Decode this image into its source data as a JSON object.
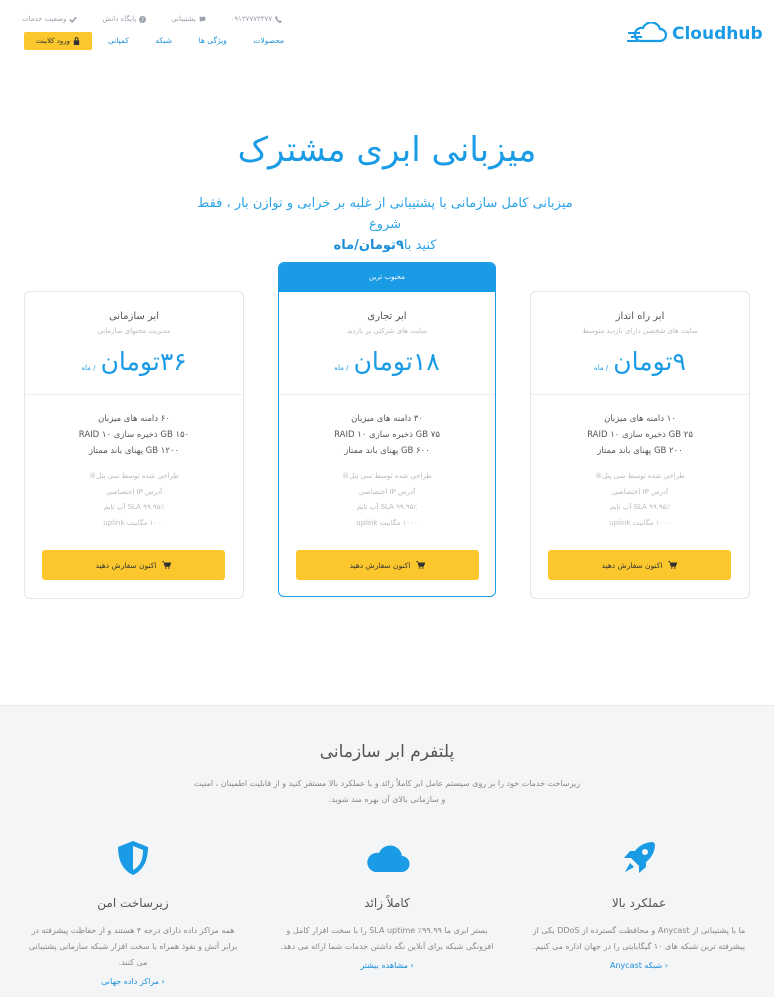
{
  "header": {
    "logo_text": "Cloudhub",
    "phone": "۰۹۱۳۷۷۷۳۳۷۷",
    "support": "پشتیبانی",
    "knowledge_base": "پایگاه دانش",
    "service_status": "وضعیت خدمات",
    "nav": [
      "محصولات",
      "ویژگی ها",
      "شبکه",
      "کمپانی"
    ],
    "client_login": "ورود کلاینت"
  },
  "hero": {
    "title": "میزبانی ابری مشترک",
    "subtitle_line1": "میزبانی کامل سازمانی با پشتیبانی از غلبه بر خرابی و توازن بار ، فقط شروع",
    "subtitle_line2_prefix": "کنید با",
    "subtitle_price": "۹تومان/ماه"
  },
  "plans": [
    {
      "name": "ابر راه انداز",
      "desc": "سایت های شخصی دارای بازدید متوسط",
      "price": "۹تومان",
      "per": "/ ماه",
      "specs": [
        "۱۰ دامنه های میزبان",
        "GB ۲۵ ذخیره سازی ۱۰ RAID",
        "GB ۲۰۰ پهنای باند ممتاز"
      ],
      "features": [
        "طراحی شده توسط سی پنل®",
        "آدرس IP اختصاصی",
        "SLA ۹۹.۹۵٪ آپ تایم",
        "۱۰۰۰ مگابیت uplink"
      ],
      "order": "اکنون سفارش دهید"
    },
    {
      "badge": "محبوب ترین",
      "name": "ابر تجاری",
      "desc": "سایت های شرکتی پر بازدید",
      "price": "۱۸تومان",
      "per": "/ ماه",
      "specs": [
        "۳۰ دامنه های میزبان",
        "GB ۷۵ ذخیره سازی ۱۰ RAID",
        "GB ۶۰۰ پهنای باند ممتاز"
      ],
      "features": [
        "طراحی شده توسط سی پنل®",
        "آدرس IP اختصاصی",
        "SLA ۹۹.۹۵٪ آپ تایم",
        "۱۰۰۰ مگابیت uplink"
      ],
      "order": "اکنون سفارش دهید"
    },
    {
      "name": "ابر سازمانی",
      "desc": "مدیریت محتوای سازمانی",
      "price": "۳۶تومان",
      "per": "/ ماه",
      "specs": [
        "۶۰ دامنه های میزبان",
        "GB ۱۵۰ ذخیره سازی ۱۰ RAID",
        "GB ۱۲۰۰ پهنای باند ممتاز"
      ],
      "features": [
        "طراحی شده توسط سی پنل®",
        "آدرس IP اختصاصی",
        "SLA ۹۹.۹۵٪ آپ تایم",
        "۱۰۰۰ مگابیت uplink"
      ],
      "order": "اکنون سفارش دهید"
    }
  ],
  "platform": {
    "title": "پلتفرم ابر سازمانی",
    "desc_line1": "زیرساخت خدمات خود را بر روی سیستم عامل ابر کاملاً زائد و با عملکرد بالا مستقر کنید و از قابلیت اطمینان ، امنیت",
    "desc_line2": "و سازمانی بالای آن بهره مند شوید.",
    "features": [
      {
        "icon": "rocket-icon",
        "title": "عملکرد بالا",
        "text": "ما با پشتیبانی از Anycast و محافظت گسترده از DDoS یکی از پیشرفته ترین شبکه های ۱۰ گیگابایتی را در جهان اداره می کنیم.",
        "link": "شبکه Anycast"
      },
      {
        "icon": "cloud-icon",
        "title": "کاملاً زائد",
        "text": "بستر ابری ما ۹۹.۹۹٪ SLA uptime را با سخت افزار کامل و افزونگی شبکه برای آنلاین نگه داشتن خدمات شما ارائه می دهد.",
        "link": "مشاهده بیشتر"
      },
      {
        "icon": "shield-icon",
        "title": "زیرساخت امن",
        "text": "همه مراکز داده دارای درجه ۴ هستند و از حفاظت پیشرفته در برابر آتش و نفوذ همراه با سخت افزار شبکه سازمانی پشتیبانی می کنند.",
        "link": "مراکز داده جهانی"
      }
    ]
  }
}
